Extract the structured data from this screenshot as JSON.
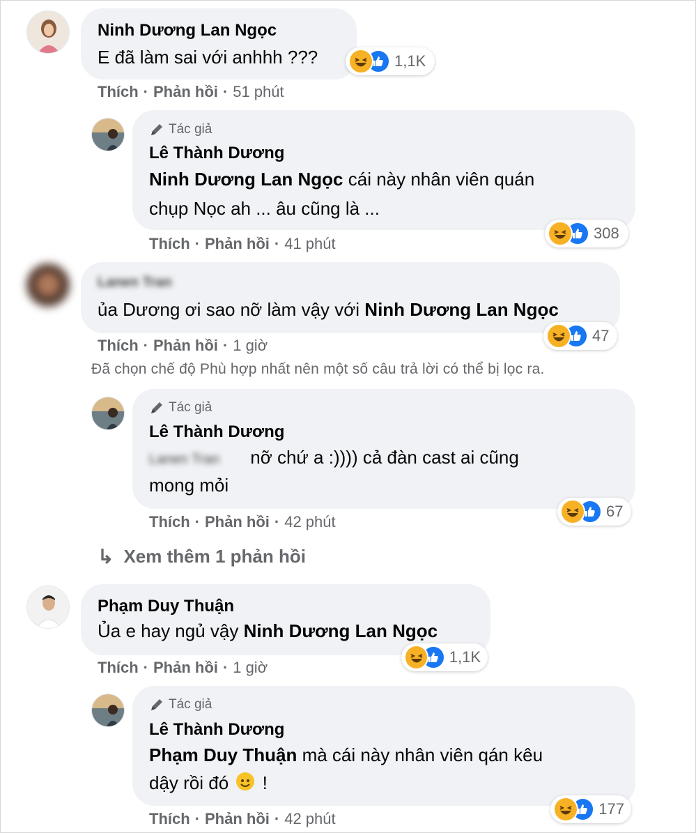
{
  "comments": [
    {
      "author": "Ninh Dương Lan Ngọc",
      "text": "E đã làm sai với anhhh ???",
      "reactions": "1,1K",
      "like": "Thích",
      "reply": "Phản hồi",
      "time": "51 phút"
    },
    {
      "author_badge": "Tác giả",
      "author": "Lê Thành Dương",
      "mention": "Ninh Dương Lan Ngọc",
      "text_line1": " cái này nhân viên quán",
      "text_line2": "chụp Nọc ah ... âu cũng là ...",
      "reactions": "308",
      "like": "Thích",
      "reply": "Phản hồi",
      "time": "41 phút"
    },
    {
      "author": "Lanen Tran",
      "text": "ủa Dương ơi sao nỡ làm vậy với ",
      "mention": "Ninh Dương Lan Ngọc",
      "reactions": "47",
      "like": "Thích",
      "reply": "Phản hồi",
      "time": "1 giờ"
    },
    {
      "author_badge": "Tác giả",
      "author": "Lê Thành Dương",
      "mention": "Lanen Tran",
      "text_line1": "nỡ chứ a :)))) cả đàn cast ai cũng",
      "text_line2": "mong mỏi",
      "reactions": "67",
      "like": "Thích",
      "reply": "Phản hồi",
      "time": "42 phút"
    },
    {
      "author": "Phạm Duy Thuận",
      "text": "Ủa e hay ngủ vậy ",
      "mention": "Ninh Dương Lan Ngọc",
      "reactions": "1,1K",
      "like": "Thích",
      "reply": "Phản hồi",
      "time": "1 giờ"
    },
    {
      "author_badge": "Tác giả",
      "author": "Lê Thành Dương",
      "mention": "Phạm Duy Thuận",
      "text_line1": " mà cái này nhân viên qán kêu",
      "text_line2": "dậy rồi đó ",
      "text_line2_end": " !",
      "reactions": "177",
      "like": "Thích",
      "reply": "Phản hồi",
      "time": "42 phút"
    }
  ],
  "filter_notice": "Đã chọn chế độ Phù hợp nhất nên một số câu trả lời có thể bị lọc ra.",
  "see_more": "Xem thêm 1 phản hồi",
  "dot": "·",
  "icons": {
    "reply_arrow": "↳",
    "author_badge": "pencil-icon",
    "reaction_haha": "haha-icon",
    "reaction_like": "like-icon"
  },
  "colors": {
    "bubble": "#f0f2f5",
    "meta": "#65676b",
    "like_blue": "#1877f2",
    "haha_yellow": "#f7b125"
  }
}
